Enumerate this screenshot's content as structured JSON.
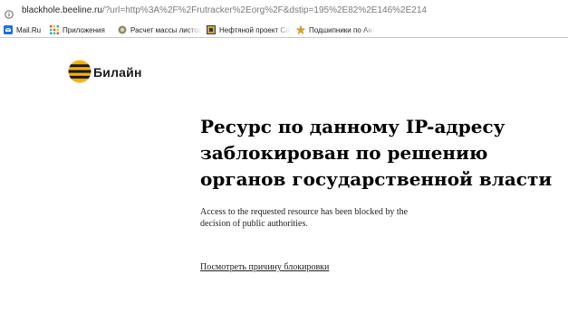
{
  "browser": {
    "url_host": "blackhole.beeline.ru",
    "url_rest": "/?url=http%3A%2F%2Frutracker%2Eorg%2F&dstip=195%2E82%2E146%2E214",
    "bookmarks": [
      {
        "label": "Mail.Ru",
        "icon": "mailru-icon"
      },
      {
        "label": "Приложения",
        "icon": "apps-grid-icon"
      },
      {
        "label": "Расчет массы листов",
        "icon": "calculator-site-icon"
      },
      {
        "label": "Нефтяной проект Са",
        "icon": "oil-project-icon"
      },
      {
        "label": "Подшипники по Ант",
        "icon": "bearings-star-icon"
      }
    ]
  },
  "page": {
    "logo_text": "Билайн",
    "logo_colors": {
      "yellow": "#f5b400",
      "black": "#1a1a1a"
    },
    "heading": "Ресурс по данному IP-адресу заблокирован по решению органов государственной власти",
    "subtext": "Access to the requested resource has been blocked by the decision of public authorities.",
    "reason_link": "Посмотреть причину блокировки"
  }
}
